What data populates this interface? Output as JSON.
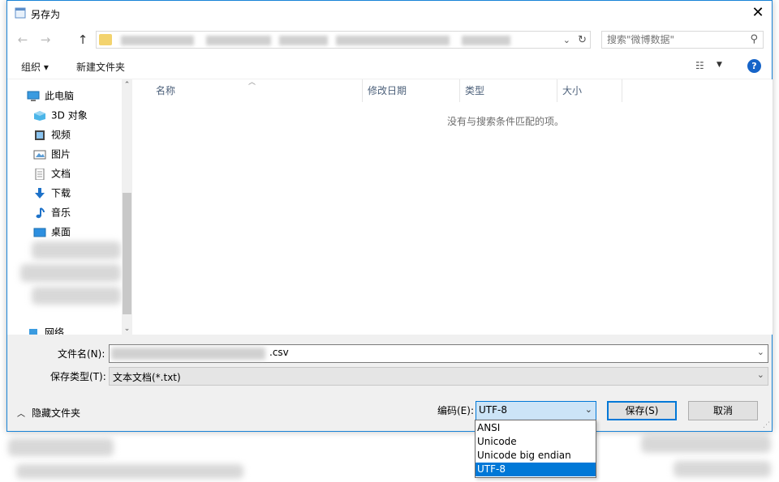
{
  "window": {
    "title": "另存为"
  },
  "address": {
    "search_placeholder": "搜索\"微博数据\""
  },
  "toolbar": {
    "organize": "组织 ▾",
    "new_folder": "新建文件夹"
  },
  "nav_pane": {
    "items": [
      {
        "label": "此电脑",
        "icon": "computer-icon"
      },
      {
        "label": "3D 对象",
        "icon": "cube-icon"
      },
      {
        "label": "视频",
        "icon": "video-icon"
      },
      {
        "label": "图片",
        "icon": "picture-icon"
      },
      {
        "label": "文档",
        "icon": "document-icon"
      },
      {
        "label": "下载",
        "icon": "download-icon"
      },
      {
        "label": "音乐",
        "icon": "music-icon"
      },
      {
        "label": "桌面",
        "icon": "desktop-icon"
      },
      {
        "label": "网络",
        "icon": "network-icon"
      }
    ]
  },
  "file_list": {
    "columns": [
      "名称",
      "修改日期",
      "类型",
      "大小"
    ],
    "empty_message": "没有与搜索条件匹配的项。"
  },
  "form": {
    "filename_label": "文件名(N):",
    "filename_ext": ".csv",
    "filetype_label": "保存类型(T):",
    "filetype_value": "文本文档(*.txt)",
    "hide_folders": "隐藏文件夹",
    "encoding_label": "编码(E):",
    "encoding_value": "UTF-8",
    "save_button": "保存(S)",
    "cancel_button": "取消"
  },
  "encoding_options": [
    "ANSI",
    "Unicode",
    "Unicode big endian",
    "UTF-8"
  ],
  "colors": {
    "accent": "#0078d7",
    "selection": "#cce4f7",
    "column_header": "#4c607a"
  }
}
